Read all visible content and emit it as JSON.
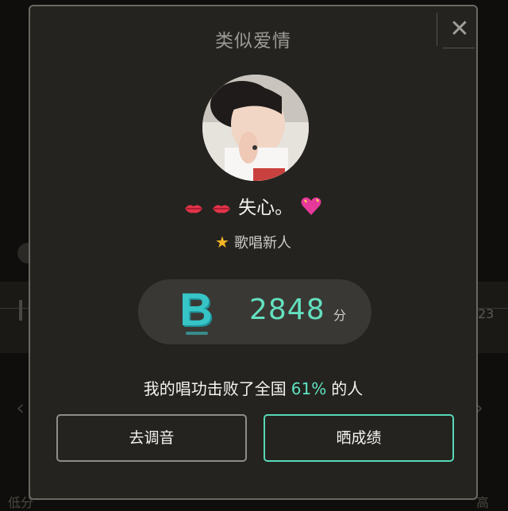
{
  "dialog": {
    "title": "类似爱情",
    "close_glyph": "✕"
  },
  "user": {
    "name": "失心。",
    "level": "歌唱新人"
  },
  "score": {
    "grade": "B",
    "value": "2848",
    "unit": "分"
  },
  "result": {
    "prefix": "我的唱功击败了全国",
    "percent": "61%",
    "suffix": "的人"
  },
  "buttons": {
    "tune_label": "去调音",
    "share_label": "晒成绩"
  },
  "background": {
    "right_number": "23",
    "bottom_left": "低分",
    "bottom_right": "高"
  },
  "colors": {
    "accent": "#5de3c1",
    "grade_teal": "#2fb7b9",
    "dialog_bg": "#25231f",
    "star": "#f3b624"
  }
}
